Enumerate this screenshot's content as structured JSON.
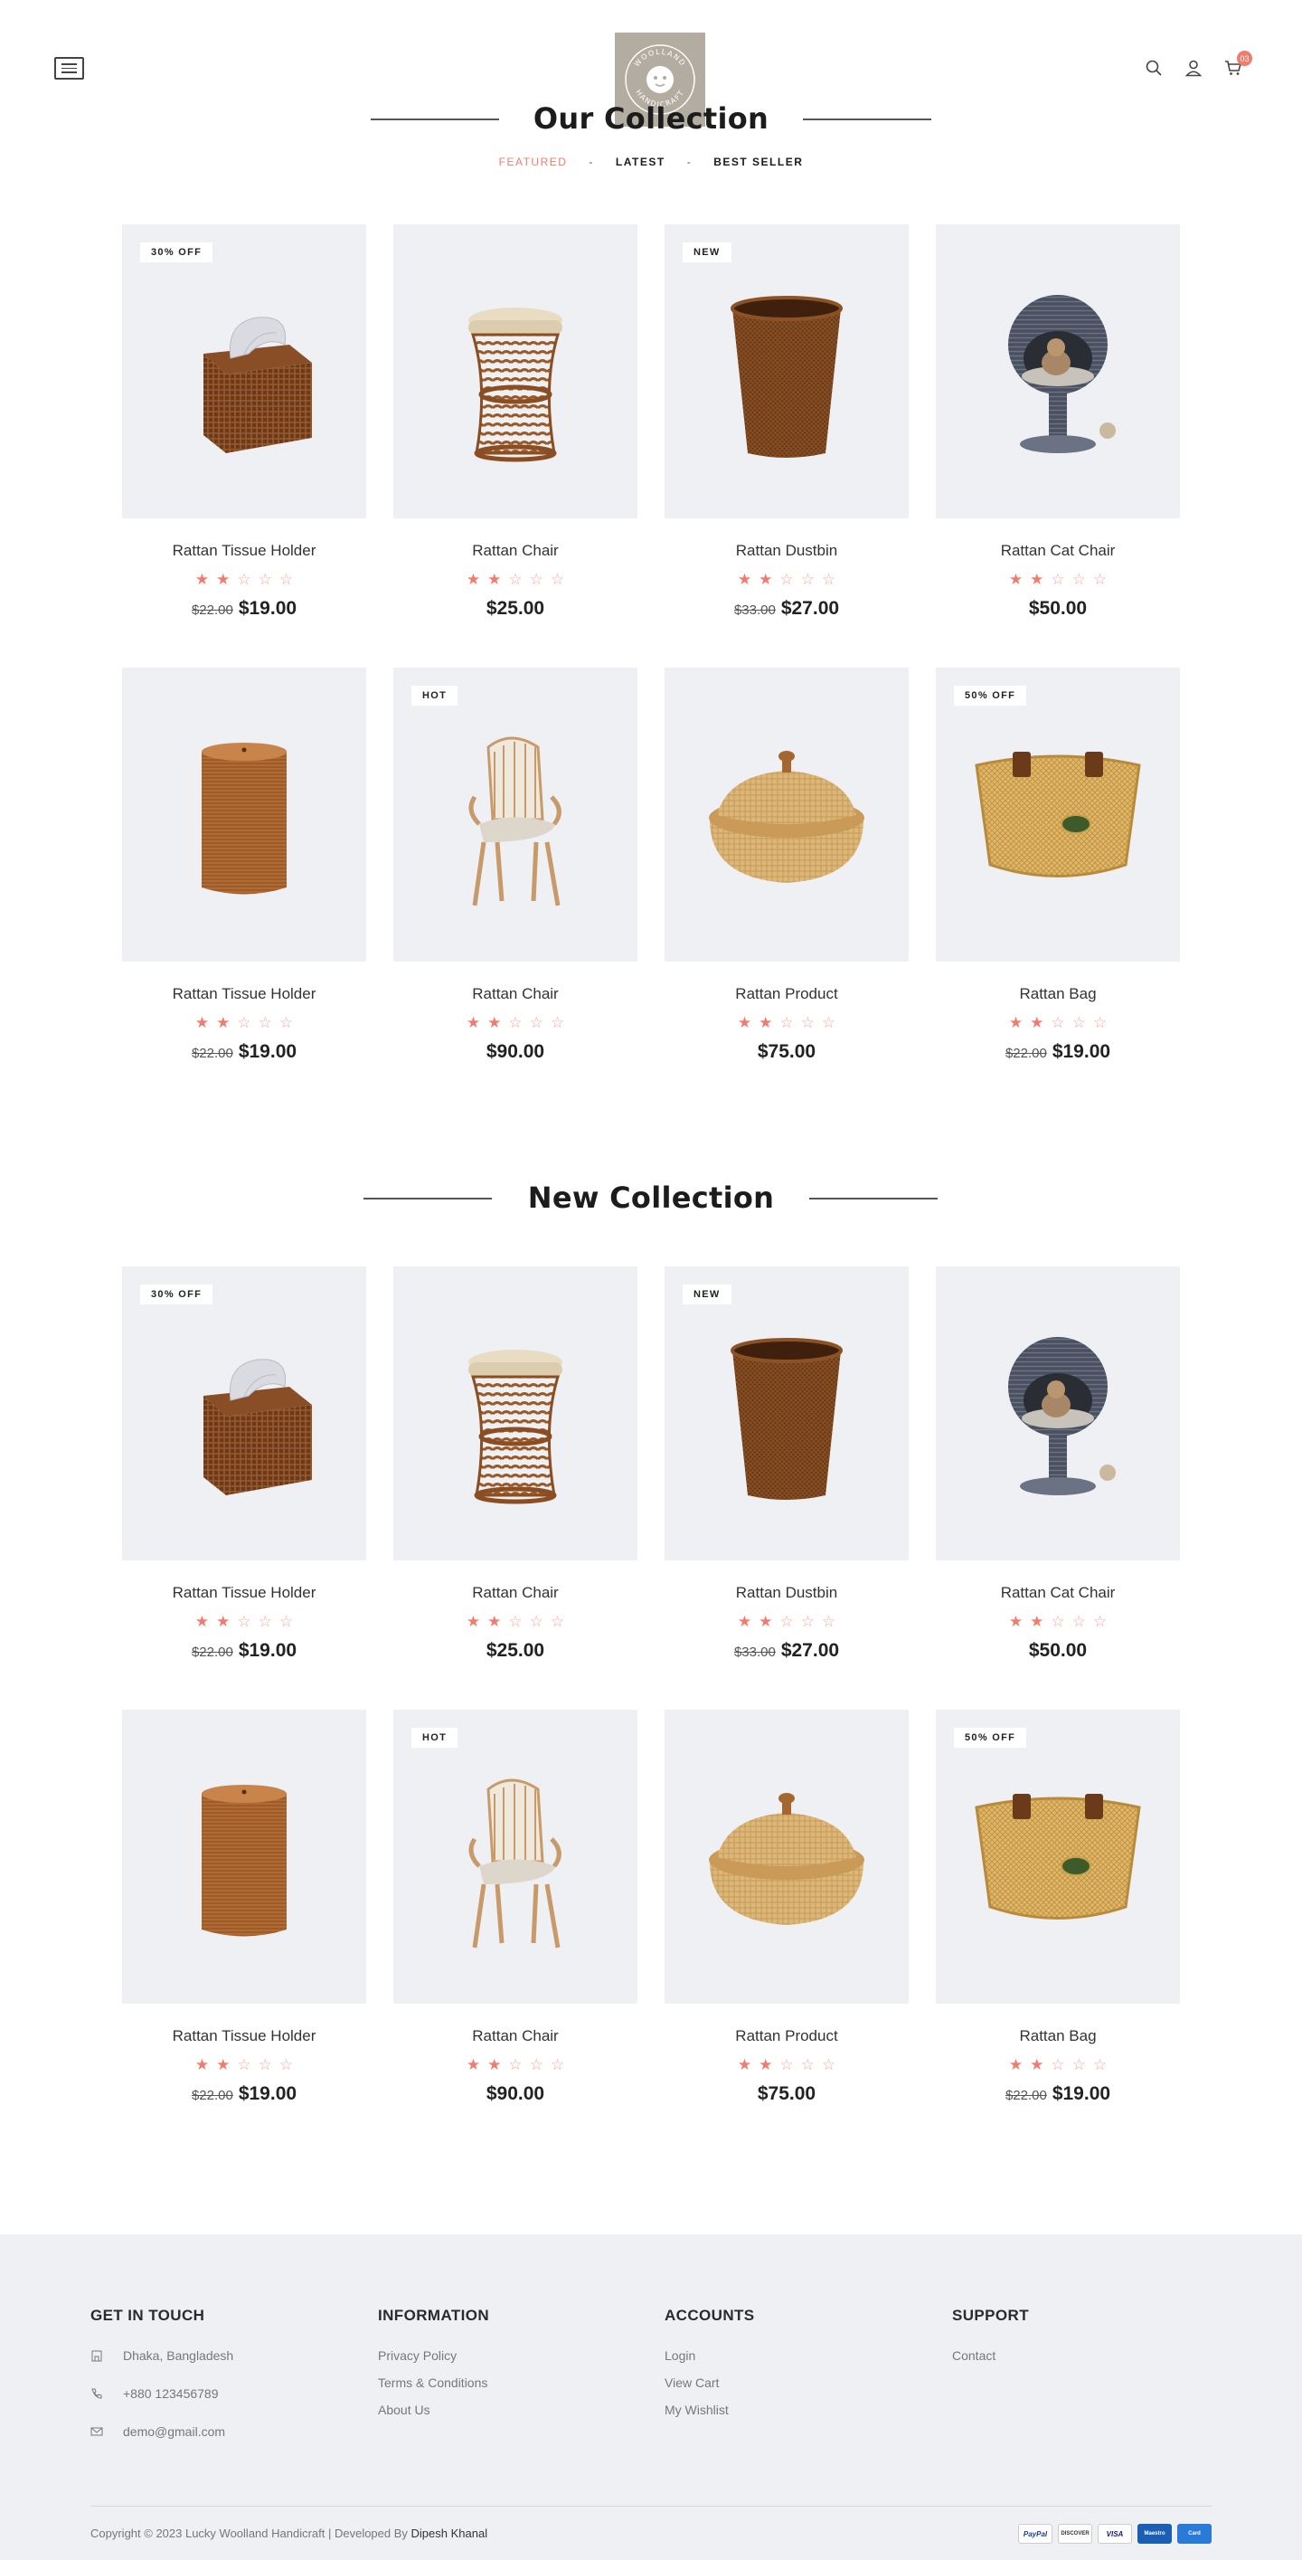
{
  "header": {
    "logo_text_top": "WOOLLAND",
    "logo_text_bottom": "HANDICRAFT",
    "cart_count": "03",
    "icons": [
      "menu-icon",
      "search-icon",
      "user-icon",
      "cart-icon"
    ]
  },
  "our_collection": {
    "title": "Our Collection",
    "filters": [
      {
        "label": "FEATURED",
        "active": true
      },
      {
        "label": "LATEST",
        "active": false
      },
      {
        "label": "BEST SELLER",
        "active": false
      }
    ],
    "filter_separator": "-"
  },
  "new_collection": {
    "title": "New Collection"
  },
  "products": [
    {
      "name": "Rattan Tissue Holder",
      "badge": "30% OFF",
      "rating": 2,
      "old_price": "$22.00",
      "price": "$19.00",
      "image": "tissue-holder"
    },
    {
      "name": "Rattan Chair",
      "badge": "",
      "rating": 2,
      "old_price": "",
      "price": "$25.00",
      "image": "stool"
    },
    {
      "name": "Rattan Dustbin",
      "badge": "NEW",
      "rating": 2,
      "old_price": "$33.00",
      "price": "$27.00",
      "image": "dustbin"
    },
    {
      "name": "Rattan Cat Chair",
      "badge": "",
      "rating": 2,
      "old_price": "",
      "price": "$50.00",
      "image": "cat-chair"
    },
    {
      "name": "Rattan Tissue Holder",
      "badge": "",
      "rating": 2,
      "old_price": "$22.00",
      "price": "$19.00",
      "image": "hamper"
    },
    {
      "name": "Rattan Chair",
      "badge": "HOT",
      "rating": 2,
      "old_price": "",
      "price": "$90.00",
      "image": "armchair"
    },
    {
      "name": "Rattan Product",
      "badge": "",
      "rating": 2,
      "old_price": "",
      "price": "$75.00",
      "image": "lidded-basket"
    },
    {
      "name": "Rattan Bag",
      "badge": "50% OFF",
      "rating": 2,
      "old_price": "$22.00",
      "price": "$19.00",
      "image": "bike-basket"
    }
  ],
  "colors": {
    "accent": "#f07c6e",
    "card_bg": "#eff0f4",
    "logo_bg": "#b3aca0",
    "footer_bg": "#eff0f4"
  },
  "footer": {
    "get_in_touch": {
      "heading": "GET IN TOUCH",
      "address": "Dhaka, Bangladesh",
      "phone": "+880 123456789",
      "email": "demo@gmail.com"
    },
    "information": {
      "heading": "INFORMATION",
      "links": [
        "Privacy Policy",
        "Terms & Conditions",
        "About Us"
      ]
    },
    "accounts": {
      "heading": "ACCOUNTS",
      "links": [
        "Login",
        "View Cart",
        "My Wishlist"
      ]
    },
    "support": {
      "heading": "SUPPORT",
      "links": [
        "Contact"
      ]
    },
    "copyright_prefix": "Copyright © 2023 Lucky Woolland Handicraft | Developed By",
    "developer": "Dipesh Khanal",
    "payments": [
      "PayPal",
      "DISCOVER",
      "VISA",
      "Maestro",
      "Card"
    ]
  }
}
